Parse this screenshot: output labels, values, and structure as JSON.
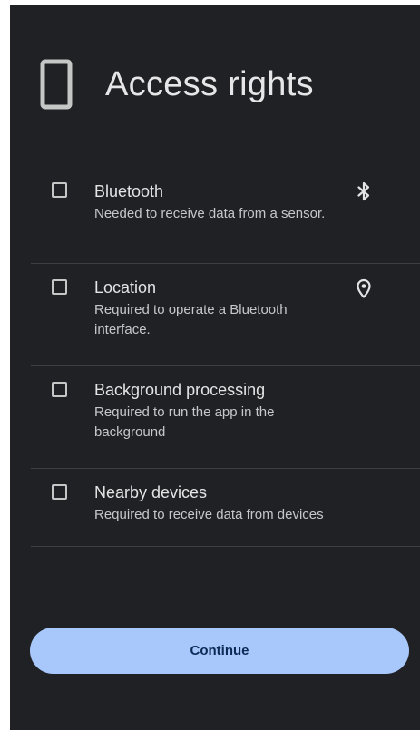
{
  "header": {
    "title": "Access rights",
    "icon": "phone-icon"
  },
  "permissions": [
    {
      "title": "Bluetooth",
      "description": "Needed to receive data from a sensor.",
      "checked": false,
      "icon": "bluetooth-icon"
    },
    {
      "title": "Location",
      "description": "Required to operate a Bluetooth interface.",
      "checked": false,
      "icon": "location-pin-icon"
    },
    {
      "title": "Background processing",
      "description": "Required to run the app in the background",
      "checked": false
    },
    {
      "title": "Nearby devices",
      "description": "Required to receive data from devices",
      "checked": false
    }
  ],
  "continue_label": "Continue",
  "colors": {
    "background": "#202124",
    "accent": "#a8c7fa",
    "divider": "#3d3e42",
    "text_primary": "#e4e4e6",
    "text_secondary": "#c6c7ca"
  }
}
